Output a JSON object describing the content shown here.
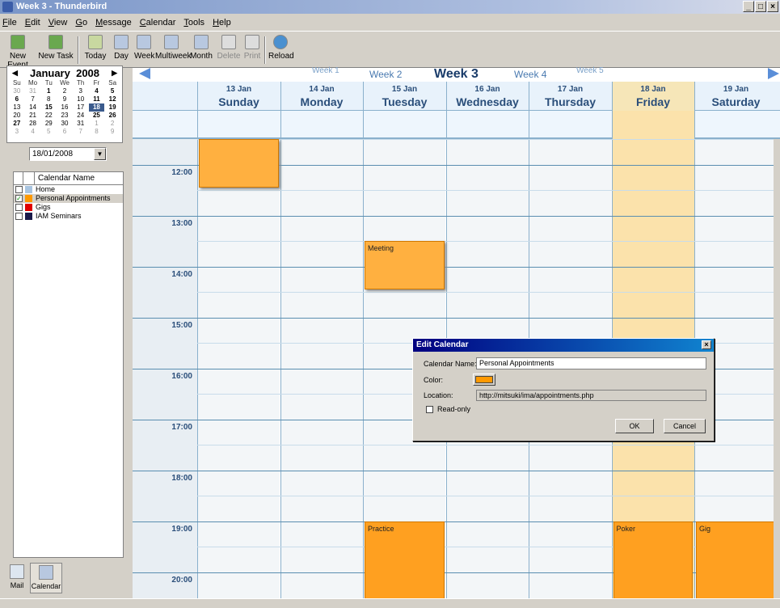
{
  "window": {
    "title": "Week 3 - Thunderbird",
    "controls": [
      "_",
      "□",
      "×"
    ]
  },
  "menu": [
    "File",
    "Edit",
    "View",
    "Go",
    "Message",
    "Calendar",
    "Tools",
    "Help"
  ],
  "toolbar": {
    "new_event": "New Event",
    "new_task": "New Task",
    "today": "Today",
    "day": "Day",
    "week": "Week",
    "multiweek": "Multiweek",
    "month": "Month",
    "delete": "Delete",
    "print": "Print",
    "reload": "Reload"
  },
  "minical": {
    "month": "January",
    "year": "2008",
    "weekdays": [
      "Su",
      "Mo",
      "Tu",
      "We",
      "Th",
      "Fr",
      "Sa"
    ],
    "days": [
      "30",
      "31",
      "1",
      "2",
      "3",
      "4",
      "5",
      "6",
      "7",
      "8",
      "9",
      "10",
      "11",
      "12",
      "13",
      "14",
      "15",
      "16",
      "17",
      "18",
      "19",
      "20",
      "21",
      "22",
      "23",
      "24",
      "25",
      "26",
      "27",
      "28",
      "29",
      "30",
      "31",
      "1",
      "2",
      "3",
      "4",
      "5",
      "6",
      "7",
      "8",
      "9"
    ]
  },
  "date_picker": {
    "value": "18/01/2008"
  },
  "calendar_list": {
    "header": "Calendar Name",
    "items": [
      {
        "name": "Home",
        "checked": false,
        "color": "#a8c4e0"
      },
      {
        "name": "Personal Appointments",
        "checked": true,
        "color": "#ff9900"
      },
      {
        "name": "Gigs",
        "checked": false,
        "color": "#e00000"
      },
      {
        "name": "IAM Seminars",
        "checked": false,
        "color": "#1a1a4a"
      }
    ]
  },
  "modes": {
    "mail": "Mail",
    "calendar": "Calendar"
  },
  "week_nav": {
    "weeks": [
      "Week 1",
      "Week 2",
      "Week 3",
      "Week 4",
      "Week 5"
    ],
    "current": "Week 3"
  },
  "days": [
    {
      "date": "13 Jan",
      "name": "Sunday"
    },
    {
      "date": "14 Jan",
      "name": "Monday"
    },
    {
      "date": "15 Jan",
      "name": "Tuesday"
    },
    {
      "date": "16 Jan",
      "name": "Wednesday"
    },
    {
      "date": "17 Jan",
      "name": "Thursday"
    },
    {
      "date": "18 Jan",
      "name": "Friday"
    },
    {
      "date": "19 Jan",
      "name": "Saturday"
    }
  ],
  "hours": [
    "12:00",
    "13:00",
    "14:00",
    "15:00",
    "16:00",
    "17:00",
    "18:00",
    "19:00",
    "20:00"
  ],
  "events": [
    {
      "title": "",
      "day": "Sunday",
      "start": "11:30",
      "end": "12:30"
    },
    {
      "title": "Meeting",
      "day": "Tuesday",
      "start": "13:30",
      "end": "14:30"
    },
    {
      "title": "Practice",
      "day": "Tuesday",
      "start": "19:00",
      "end": "21:00"
    },
    {
      "title": "Poker",
      "day": "Friday",
      "start": "19:00",
      "end": "21:00"
    },
    {
      "title": "Gig",
      "day": "Saturday",
      "start": "19:00",
      "end": "21:00"
    }
  ],
  "dialog": {
    "title": "Edit Calendar",
    "name_label": "Calendar Name:",
    "name_value": "Personal Appointments",
    "color_label": "Color:",
    "color_value": "#ff9900",
    "location_label": "Location:",
    "location_value": "http://mitsuki/ima/appointments.php",
    "readonly_label": "Read-only",
    "ok": "OK",
    "cancel": "Cancel",
    "close": "×"
  }
}
